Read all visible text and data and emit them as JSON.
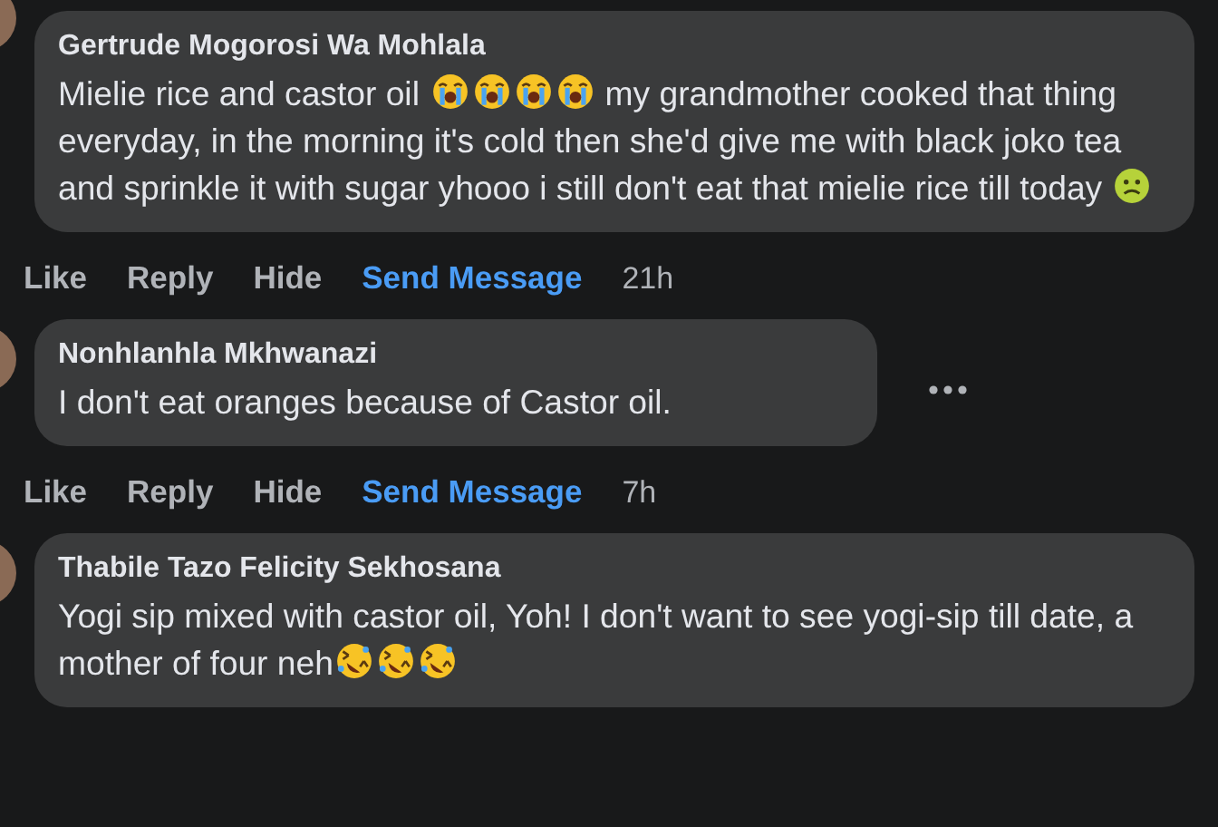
{
  "comments": [
    {
      "author": "Gertrude Mogorosi Wa Mohlala",
      "menu": false,
      "parts": [
        {
          "kind": "text",
          "text": "Mielie rice and castor oil "
        },
        {
          "kind": "crying"
        },
        {
          "kind": "crying"
        },
        {
          "kind": "crying"
        },
        {
          "kind": "crying"
        },
        {
          "kind": "text",
          "text": " my grandmother cooked that thing everyday, in the morning it's cold then she'd give me with black joko tea and sprinkle it with sugar yhooo i still don't eat that mielie rice till today "
        },
        {
          "kind": "sick"
        }
      ],
      "actions": [
        {
          "kind": "plain",
          "label": "Like"
        },
        {
          "kind": "plain",
          "label": "Reply"
        },
        {
          "kind": "plain",
          "label": "Hide"
        },
        {
          "kind": "accent",
          "label": "Send Message"
        }
      ],
      "time": "21h"
    },
    {
      "author": "Nonhlanhla Mkhwanazi",
      "menu": true,
      "parts": [
        {
          "kind": "text",
          "text": "I don't eat oranges because of Castor oil."
        }
      ],
      "actions": [
        {
          "kind": "plain",
          "label": "Like"
        },
        {
          "kind": "plain",
          "label": "Reply"
        },
        {
          "kind": "plain",
          "label": "Hide"
        },
        {
          "kind": "accent",
          "label": "Send Message"
        }
      ],
      "time": "7h"
    },
    {
      "author": "Thabile Tazo Felicity Sekhosana",
      "menu": false,
      "parts": [
        {
          "kind": "text",
          "text": "Yogi sip mixed with castor oil, Yoh! I don't want to see yogi-sip till date, a mother of four neh"
        },
        {
          "kind": "laughing"
        },
        {
          "kind": "laughing"
        },
        {
          "kind": "laughing"
        }
      ]
    }
  ]
}
